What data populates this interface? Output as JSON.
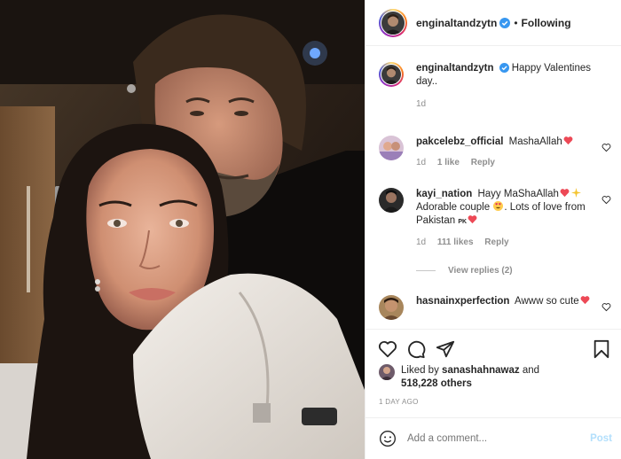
{
  "post": {
    "author": "enginaltandzytn",
    "follow_label": "Following",
    "caption": {
      "username": "enginaltandzytn",
      "text": "Happy Valentines day..",
      "time": "1d"
    },
    "comments": [
      {
        "username": "pakcelebz_official",
        "text": "MashaAllah",
        "emoji": [
          "heart"
        ],
        "time": "1d",
        "likes": "1 like",
        "reply_label": "Reply"
      },
      {
        "username": "kayi_nation",
        "text_parts": [
          "Hayy MaShaAllah",
          "Adorable couple",
          ". Lots of love from Pakistan"
        ],
        "flag_text": "PK",
        "time": "1d",
        "likes": "111 likes",
        "reply_label": "Reply",
        "view_replies": "View replies (2)"
      },
      {
        "username": "hasnainxperfection",
        "text": "Awww so cute",
        "emoji": [
          "heart"
        ]
      }
    ],
    "liked_by": {
      "prefix": "Liked by",
      "username": "sanashahnawaz",
      "middle": "and",
      "count": "518,228 others"
    },
    "posted_ago": "1 DAY AGO",
    "add_comment": {
      "placeholder": "Add a comment...",
      "post_label": "Post"
    },
    "icons": [
      "verified-badge",
      "heart",
      "comment-bubble",
      "share-plane",
      "bookmark",
      "smiley"
    ],
    "colors": {
      "verified": "#3897f0",
      "heart_red": "#ed4956",
      "post_button_disabled": "#b2dffc",
      "muted_text": "#8e8e8e"
    }
  }
}
